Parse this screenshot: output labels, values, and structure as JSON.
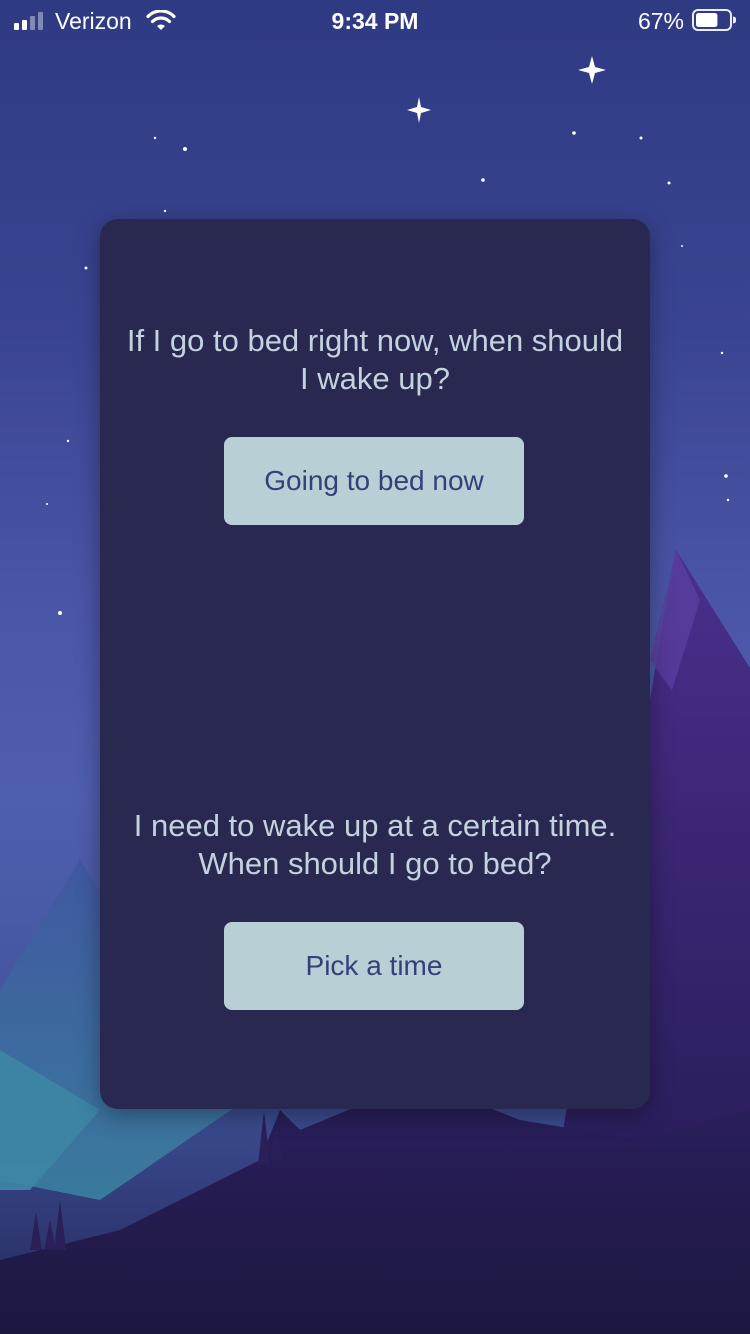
{
  "status_bar": {
    "carrier": "Verizon",
    "time": "9:34 PM",
    "battery_percent": "67%",
    "battery_level": 0.67,
    "signal_bars": 2,
    "icons": [
      "signal-icon",
      "wifi-icon",
      "battery-icon"
    ]
  },
  "card": {
    "question_now": "If I go to bed right now, when should I wake up?",
    "button_now": "Going to bed now",
    "question_wake": "I need to wake up at a certain time. When should I go to bed?",
    "button_wake": "Pick a time"
  },
  "colors": {
    "card_background": "#282851",
    "button_background": "#b9cfd6",
    "button_text": "#34407a",
    "question_text": "#c3d2df"
  }
}
